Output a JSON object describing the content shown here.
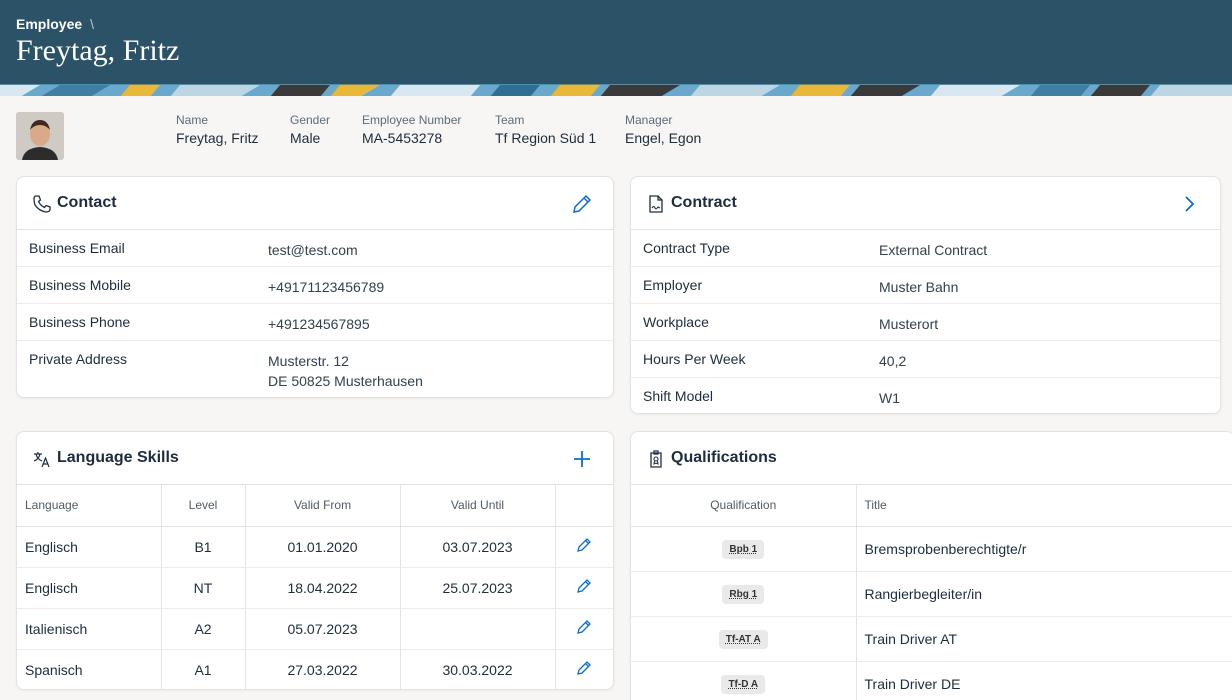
{
  "header": {
    "breadcrumb": "Employee",
    "breadcrumb_sep": "\\",
    "title": "Freytag, Fritz"
  },
  "colors": {
    "header_bg": "#2c5268",
    "accent": "#0a6ed1"
  },
  "profile": {
    "fields": [
      {
        "label": "Name",
        "value": "Freytag, Fritz"
      },
      {
        "label": "Gender",
        "value": "Male"
      },
      {
        "label": "Employee Number",
        "value": "MA-5453278"
      },
      {
        "label": "Team",
        "value": "Tf Region Süd 1"
      },
      {
        "label": "Manager",
        "value": "Engel, Egon"
      }
    ]
  },
  "contact": {
    "title": "Contact",
    "rows": [
      {
        "label": "Business Email",
        "value": "test@test.com"
      },
      {
        "label": "Business Mobile",
        "value": "+49171123456789"
      },
      {
        "label": "Business Phone",
        "value": "+491234567895"
      },
      {
        "label": "Private Address",
        "value": "Musterstr. 12",
        "value2": "DE 50825 Musterhausen"
      }
    ]
  },
  "contract": {
    "title": "Contract",
    "rows": [
      {
        "label": "Contract Type",
        "value": "External Contract"
      },
      {
        "label": "Employer",
        "value": "Muster Bahn"
      },
      {
        "label": "Workplace",
        "value": "Musterort"
      },
      {
        "label": "Hours Per Week",
        "value": "40,2"
      },
      {
        "label": "Shift Model",
        "value": "W1"
      }
    ]
  },
  "languages": {
    "title": "Language Skills",
    "columns": [
      "Language",
      "Level",
      "Valid From",
      "Valid Until"
    ],
    "rows": [
      {
        "language": "Englisch",
        "level": "B1",
        "from": "01.01.2020",
        "until": "03.07.2023"
      },
      {
        "language": "Englisch",
        "level": "NT",
        "from": "18.04.2022",
        "until": "25.07.2023"
      },
      {
        "language": "Italienisch",
        "level": "A2",
        "from": "05.07.2023",
        "until": ""
      },
      {
        "language": "Spanisch",
        "level": "A1",
        "from": "27.03.2022",
        "until": "30.03.2022"
      }
    ]
  },
  "qualifications": {
    "title": "Qualifications",
    "columns": [
      "Qualification",
      "Title"
    ],
    "rows": [
      {
        "code": "Bpb 1",
        "title": "Bremsprobenberechtigte/r"
      },
      {
        "code": "Rbg 1",
        "title": "Rangierbegleiter/in"
      },
      {
        "code": "Tf-AT A",
        "title": "Train Driver AT"
      },
      {
        "code": "Tf-D A",
        "title": "Train Driver DE"
      }
    ]
  }
}
